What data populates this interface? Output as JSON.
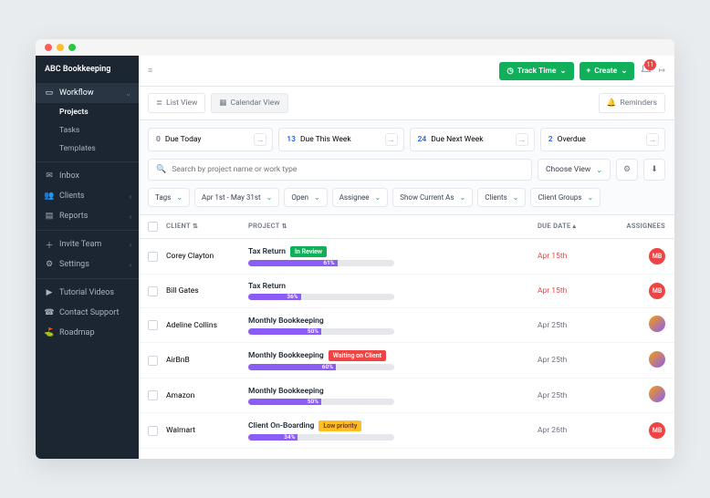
{
  "brand": "ABC Bookkeeping",
  "sidebar": {
    "workflow": "Workflow",
    "projects": "Projects",
    "tasks": "Tasks",
    "templates": "Templates",
    "inbox": "Inbox",
    "clients": "Clients",
    "reports": "Reports",
    "invite": "Invite Team",
    "settings": "Settings",
    "tutorials": "Tutorial Videos",
    "contact": "Contact Support",
    "roadmap": "Roadmap"
  },
  "topbar": {
    "trackTime": "Track Time",
    "create": "Create",
    "notifCount": "11"
  },
  "tabs": {
    "list": "List View",
    "calendar": "Calendar View",
    "reminders": "Reminders"
  },
  "cards": [
    {
      "num": "0",
      "label": "Due Today",
      "cls": "gray"
    },
    {
      "num": "13",
      "label": "Due This Week",
      "cls": "blue"
    },
    {
      "num": "24",
      "label": "Due Next Week",
      "cls": "blue"
    },
    {
      "num": "2",
      "label": "Overdue",
      "cls": "blue"
    }
  ],
  "search": {
    "placeholder": "Search by project name or work type",
    "chooseView": "Choose View"
  },
  "filters": {
    "tags": "Tags",
    "dates": "Apr 1st - May 31st",
    "open": "Open",
    "assignee": "Assignee",
    "showAs": "Show Current As",
    "clients": "Clients",
    "clientGroups": "Client Groups"
  },
  "columns": {
    "client": "CLIENT",
    "project": "PROJECT",
    "due": "DUE DATE",
    "assign": "ASSIGNEES"
  },
  "rows": [
    {
      "client": "Corey Clayton",
      "project": "Tax Return",
      "status": "In Review",
      "statusCls": "sb-green",
      "pct": 61,
      "due": "Apr 15th",
      "dueCls": "due-red",
      "av": "MB",
      "avCls": "av-red"
    },
    {
      "client": "Bill Gates",
      "project": "Tax Return",
      "status": "",
      "statusCls": "",
      "pct": 36,
      "due": "Apr 15th",
      "dueCls": "due-red",
      "av": "MB",
      "avCls": "av-red"
    },
    {
      "client": "Adeline Collins",
      "project": "Monthly Bookkeeping",
      "status": "",
      "statusCls": "",
      "pct": 50,
      "due": "Apr 25th",
      "dueCls": "due-gray",
      "av": "",
      "avCls": "av-img"
    },
    {
      "client": "AirBnB",
      "project": "Monthly Bookkeeping",
      "status": "Waiting on Client",
      "statusCls": "sb-red",
      "pct": 60,
      "due": "Apr 25th",
      "dueCls": "due-gray",
      "av": "",
      "avCls": "av-img"
    },
    {
      "client": "Amazon",
      "project": "Monthly Bookkeeping",
      "status": "",
      "statusCls": "",
      "pct": 50,
      "due": "Apr 25th",
      "dueCls": "due-gray",
      "av": "",
      "avCls": "av-img"
    },
    {
      "client": "Walmart",
      "project": "Client On-Boarding",
      "status": "Low priority",
      "statusCls": "sb-yellow",
      "pct": 34,
      "due": "Apr 26th",
      "dueCls": "due-gray",
      "av": "MB",
      "avCls": "av-red"
    }
  ]
}
